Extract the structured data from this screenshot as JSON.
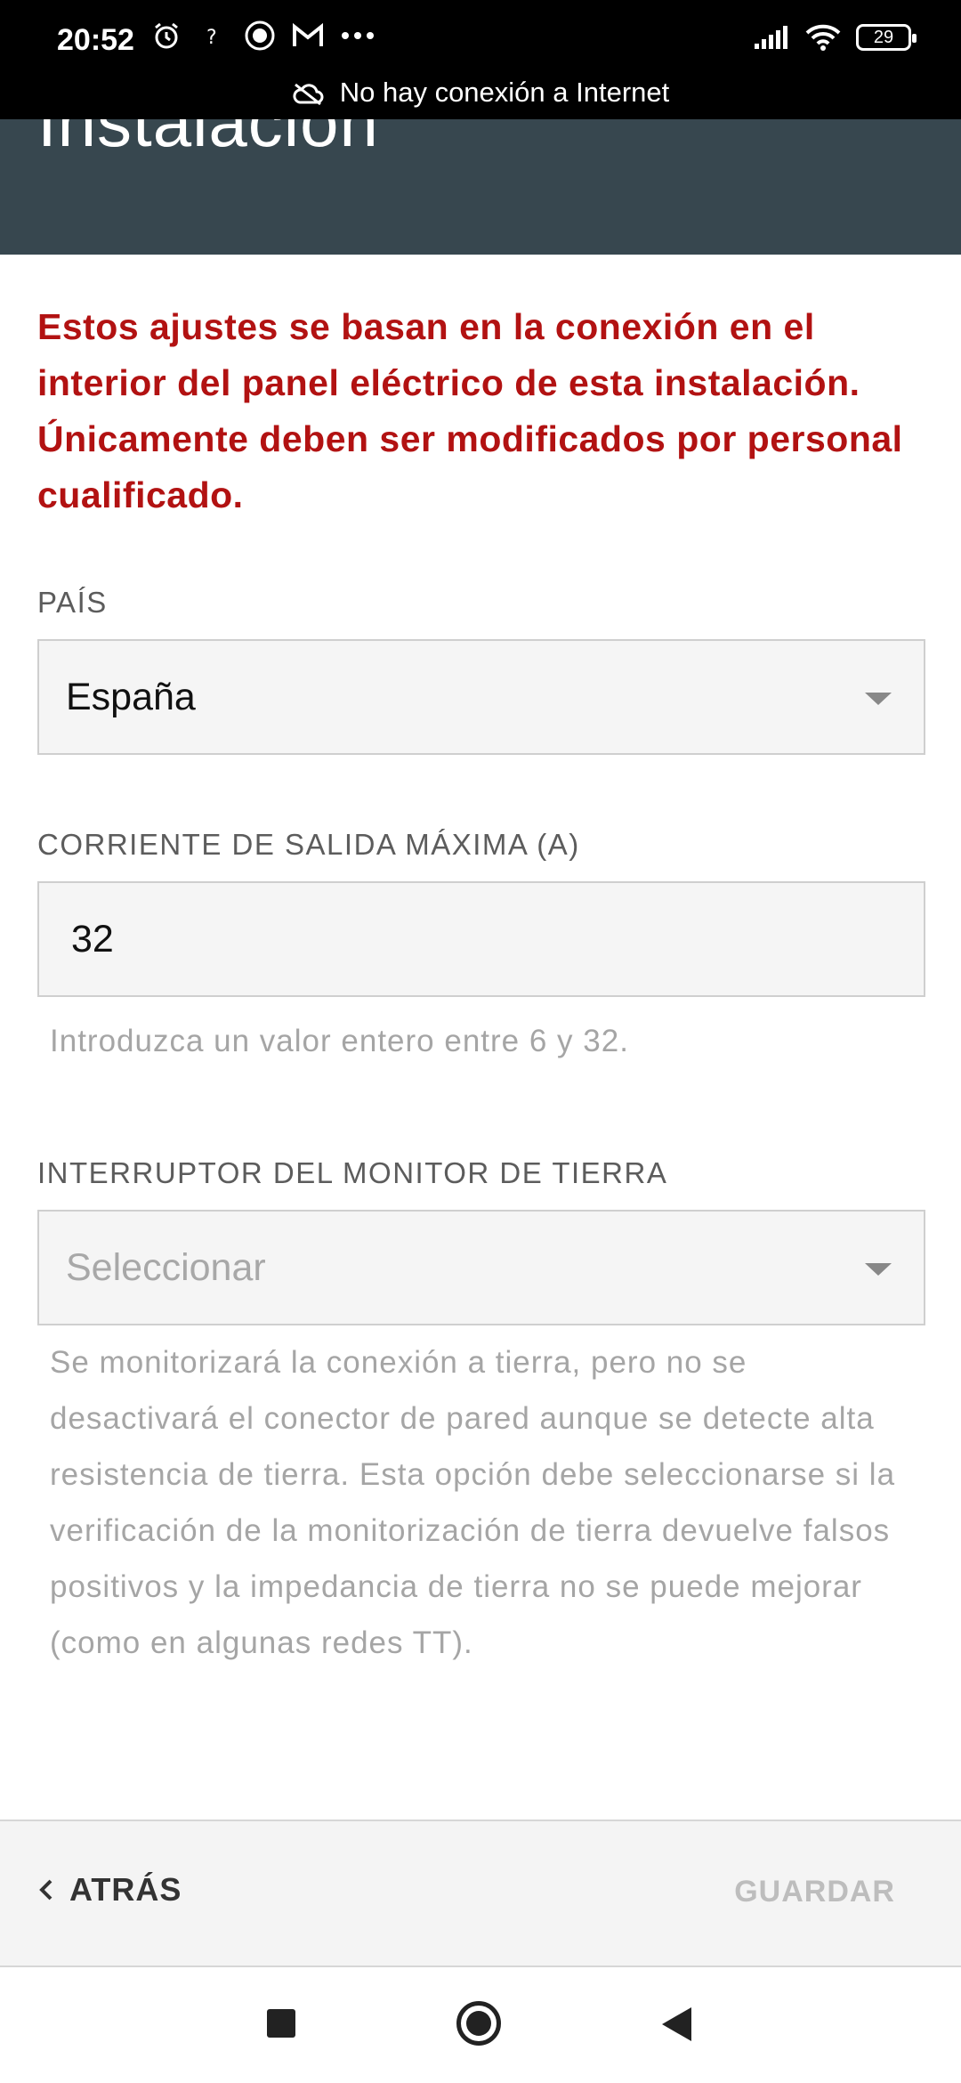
{
  "status_bar": {
    "time": "20:52",
    "battery": "29",
    "connection_text": "No hay conexión a Internet"
  },
  "header": {
    "title": "Instalación"
  },
  "warning": "Estos ajustes se basan en la conexión en el interior del panel eléctrico de esta instalación. Únicamente deben ser modificados por personal cualificado.",
  "fields": {
    "country": {
      "label": "PAÍS",
      "value": "España"
    },
    "max_current": {
      "label": "CORRIENTE DE SALIDA MÁXIMA (A)",
      "value": "32",
      "helper": "Introduzca un valor entero entre 6 y 32."
    },
    "ground_monitor": {
      "label": "INTERRUPTOR DEL MONITOR DE TIERRA",
      "placeholder": "Seleccionar",
      "helper": "Se monitorizará la conexión a tierra, pero no se desactivará el conector de pared aunque se detecte alta resistencia de tierra. Esta opción debe seleccionarse si la verificación de la monitorización de tierra devuelve falsos positivos y la impedancia de tierra no se puede mejorar (como en algunas redes TT)."
    }
  },
  "actions": {
    "back_label": "ATRÁS",
    "save_label": "GUARDAR"
  },
  "colors": {
    "header_bg": "#37474f",
    "warning": "#b21212",
    "disabled": "#bdbdbd"
  }
}
